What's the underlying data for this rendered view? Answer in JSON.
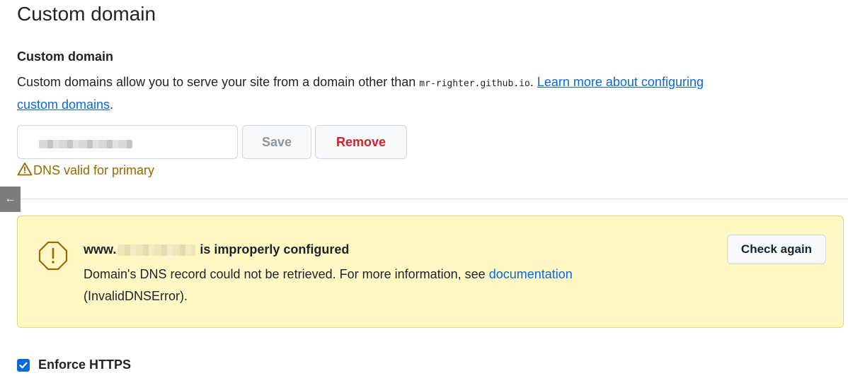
{
  "page": {
    "title": "Custom domain"
  },
  "custom_domain": {
    "heading": "Custom domain",
    "description_prefix": "Custom domains allow you to serve your site from a domain other than ",
    "default_domain": "mr-righter.github.io",
    "description_suffix": ". ",
    "learn_more_link_line1": "Learn more about configuring",
    "learn_more_link_line2": "custom domains",
    "trailing_period": ".",
    "input_value": "",
    "save_label": "Save",
    "remove_label": "Remove",
    "dns_status": "DNS valid for primary"
  },
  "collapse_tab": {
    "glyph": "←"
  },
  "warning": {
    "title_prefix": "www.",
    "title_suffix": "is improperly configured",
    "body_text": "Domain's DNS record could not be retrieved. For more information, see ",
    "documentation_link": "documentation",
    "error_code": "(InvalidDNSError).",
    "check_again_label": "Check again"
  },
  "https": {
    "label": "Enforce HTTPS",
    "checked": true
  },
  "colors": {
    "link": "#0969da",
    "danger": "#cf222e",
    "attention": "#9a6700",
    "warning_bg": "#fff8c5",
    "checkbox": "#0969da"
  }
}
